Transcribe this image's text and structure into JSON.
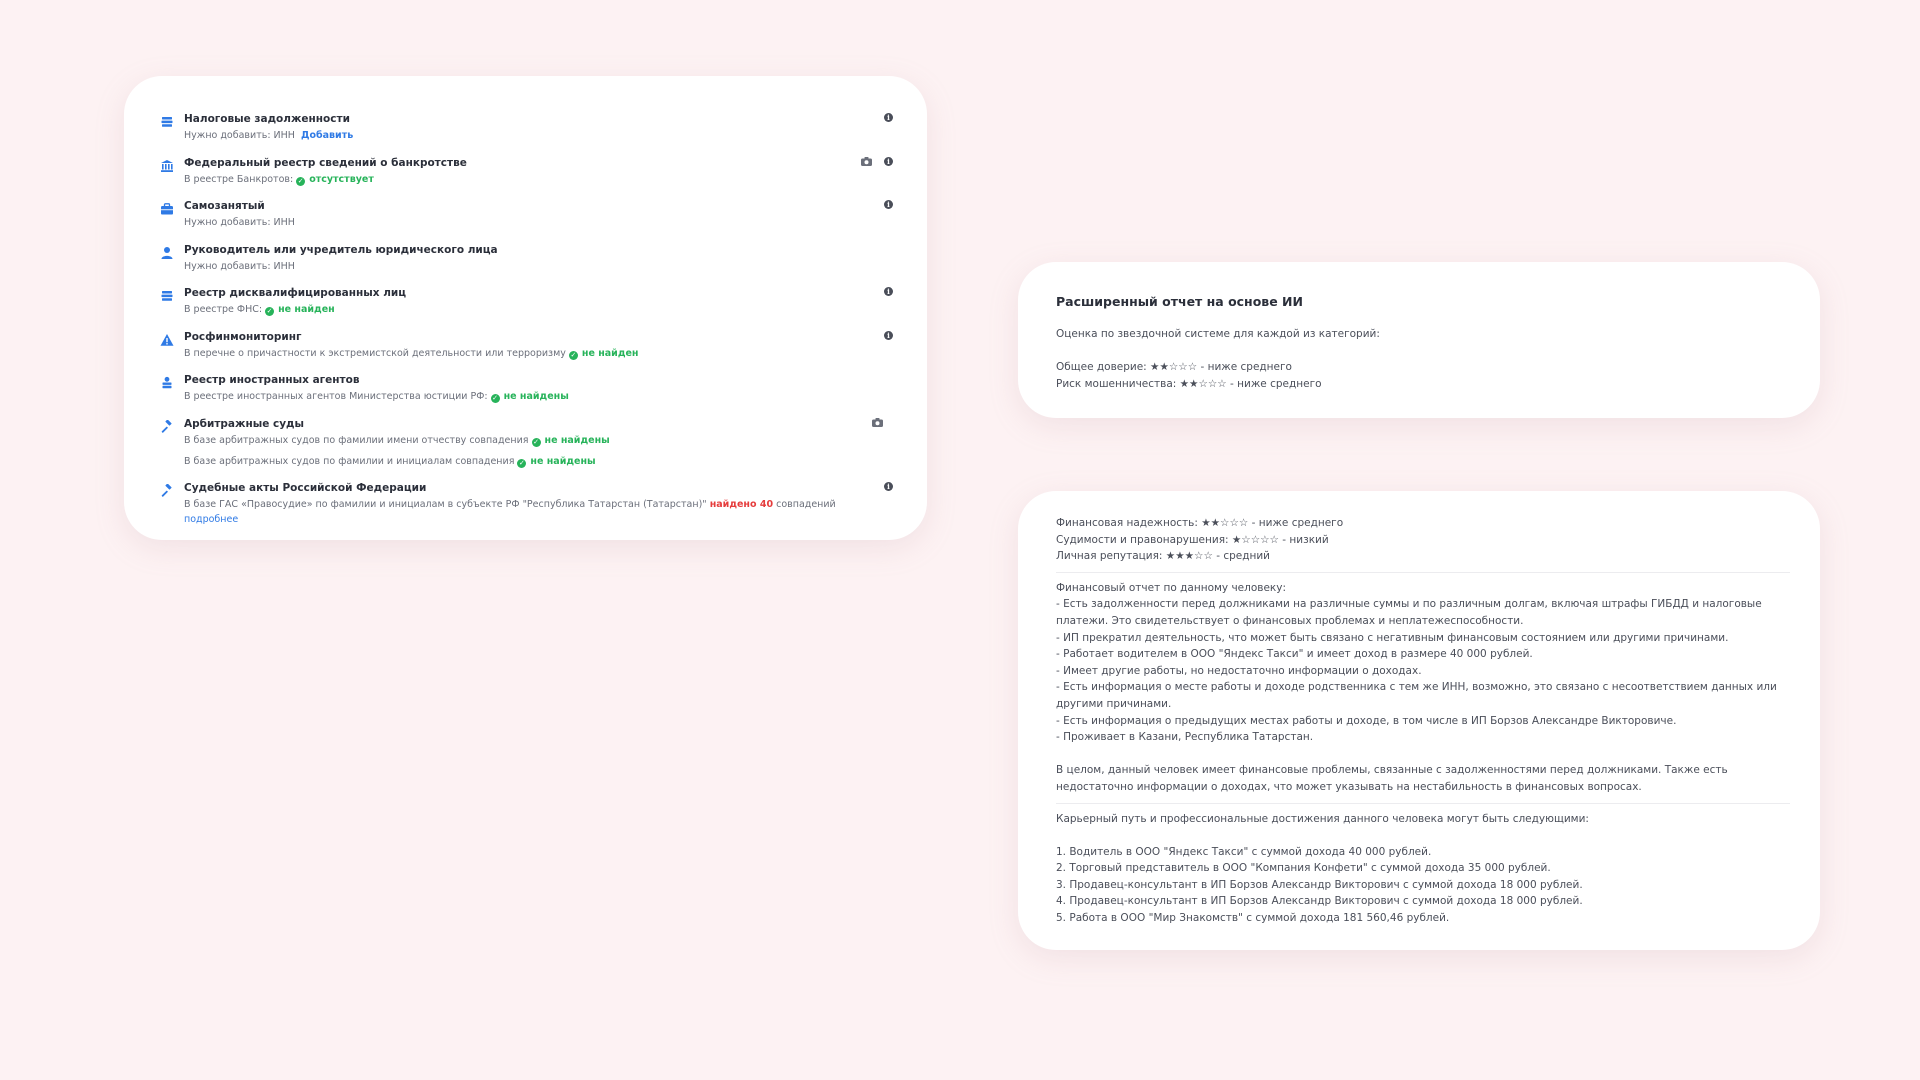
{
  "checks": [
    {
      "icon": "stack-icon",
      "title": "Налоговые задолженности",
      "sub_prefix": "Нужно добавить: ИНН",
      "link": "Добавить",
      "actions": [
        "info"
      ]
    },
    {
      "icon": "bank-icon",
      "title": "Федеральный реестр сведений о банкротстве",
      "sub_prefix": "В реестре Банкротов:",
      "status": "отсутствует",
      "actions": [
        "camera",
        "info"
      ]
    },
    {
      "icon": "briefcase-icon",
      "title": "Самозанятый",
      "sub_prefix": "Нужно добавить: ИНН",
      "actions": [
        "info"
      ]
    },
    {
      "icon": "person-icon",
      "title": "Руководитель или учредитель юридического лица",
      "sub_prefix": "Нужно добавить: ИНН",
      "actions": []
    },
    {
      "icon": "stack-icon",
      "title": "Реестр дисквалифицированных лиц",
      "sub_prefix": "В реестре ФНС:",
      "status": "не найден",
      "actions": [
        "info"
      ]
    },
    {
      "icon": "warning-icon",
      "title": "Росфинмониторинг",
      "sub_prefix": "В перечне о причастности к экстремистской деятельности или терроризму",
      "status": "не найден",
      "actions": [
        "info"
      ]
    },
    {
      "icon": "person-stack-icon",
      "title": "Реестр иностранных агентов",
      "sub_prefix": "В реестре иностранных агентов Министерства юстиции РФ:",
      "status": "не найдены",
      "actions": []
    },
    {
      "icon": "gavel-icon",
      "title": "Арбитражные суды",
      "sub_prefix": "В базе арбитражных судов по фамилии имени отчеству совпадения",
      "status": "не найдены",
      "sub2_prefix": "В базе арбитражных судов по фамилии и инициалам совпадения",
      "sub2_status": "не найдены",
      "actions": [
        "camera"
      ]
    },
    {
      "icon": "gavel-icon",
      "title": "Судебные акты Российской Федерации",
      "sub_prefix": "В базе ГАС «Правосудие» по фамилии и инициалам в субъекте РФ \"Республика Татарстан (Татарстан)\"",
      "alert": "найдено 40",
      "sub_suffix": "совпадений",
      "more_link": "подробнее",
      "actions": [
        "info"
      ]
    }
  ],
  "ai_top": {
    "heading": "Расширенный отчет на основе ИИ",
    "intro": "Оценка по звездочной системе для каждой из категорий:",
    "lines": [
      "Общее доверие: ★★☆☆☆ - ниже среднего",
      "Риск мошенничества: ★★☆☆☆ - ниже среднего"
    ]
  },
  "ai_bottom": {
    "ratings": [
      "Финансовая надежность: ★★☆☆☆ - ниже среднего",
      "Судимости и правонарушения: ★☆☆☆☆ - низкий",
      "Личная репутация: ★★★☆☆ - средний"
    ],
    "report_title": "Финансовый отчет по данному человеку:",
    "report_items": [
      "- Есть задолженности перед должниками на различные суммы и по различным долгам, включая штрафы ГИБДД и налоговые платежи. Это свидетельствует о финансовых проблемах и неплатежеспособности.",
      "- ИП прекратил деятельность, что может быть связано с негативным финансовым состоянием или другими причинами.",
      "- Работает водителем в ООО \"Яндекс Такси\" и имеет доход в размере 40 000 рублей.",
      "- Имеет другие работы, но недостаточно информации о доходах.",
      "- Есть информация о месте работы и доходе родственника с тем же ИНН, возможно, это связано с несоответствием данных или другими причинами.",
      "- Есть информация о предыдущих местах работы и доходе, в том числе в ИП Борзов Александре Викторовиче.",
      "- Проживает в Казани, Республика Татарстан."
    ],
    "summary": "В целом, данный человек имеет финансовые проблемы, связанные с задолженностями перед должниками. Также есть недостаточно информации о доходах, что может указывать на нестабильность в финансовых вопросах.",
    "career_title": "Карьерный путь и профессиональные достижения данного человека могут быть следующими:",
    "career_items": [
      "1. Водитель в ООО \"Яндекс Такси\" с суммой дохода 40 000 рублей.",
      "2. Торговый представитель в ООО \"Компания Конфети\" с суммой дохода 35 000 рублей.",
      "3. Продавец-консультант в ИП Борзов Александр Викторович с суммой дохода 18 000 рублей.",
      "4. Продавец-консультант в ИП Борзов Александр Викторович с суммой дохода 18 000 рублей.",
      "5. Работа в ООО \"Мир Знакомств\" с суммой дохода 181 560,46 рублей."
    ]
  },
  "colors": {
    "accent": "#2f7ae5",
    "ok": "#27b35a",
    "alert": "#e53c3c",
    "background": "#fdf2f3"
  }
}
